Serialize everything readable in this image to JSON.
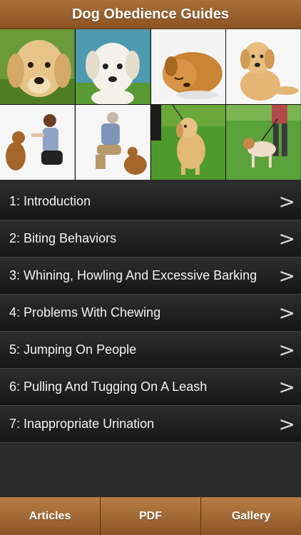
{
  "header": {
    "title": "Dog Obedience Guides"
  },
  "photos": [
    {
      "icon": "puppy-golden-photo"
    },
    {
      "icon": "puppy-white-photo"
    },
    {
      "icon": "puppy-sleeping-photo"
    },
    {
      "icon": "dog-sitting-photo"
    },
    {
      "icon": "woman-training-dog-photo"
    },
    {
      "icon": "man-training-dog-photo"
    },
    {
      "icon": "dog-on-leash-photo"
    },
    {
      "icon": "dog-walking-photo"
    }
  ],
  "articles": [
    {
      "label": "1: Introduction"
    },
    {
      "label": "2: Biting Behaviors"
    },
    {
      "label": "3: Whining, Howling And Excessive Barking"
    },
    {
      "label": "4: Problems With Chewing"
    },
    {
      "label": "5: Jumping On People"
    },
    {
      "label": "6: Pulling And Tugging On A Leash"
    },
    {
      "label": "7: Inappropriate Urination"
    }
  ],
  "chevron": ">",
  "tabs": [
    {
      "label": "Articles"
    },
    {
      "label": "PDF"
    },
    {
      "label": "Gallery"
    }
  ],
  "colors": {
    "accent": "#9a6330",
    "row_bg": "#1e1e1e",
    "text": "#f2f2f2"
  }
}
